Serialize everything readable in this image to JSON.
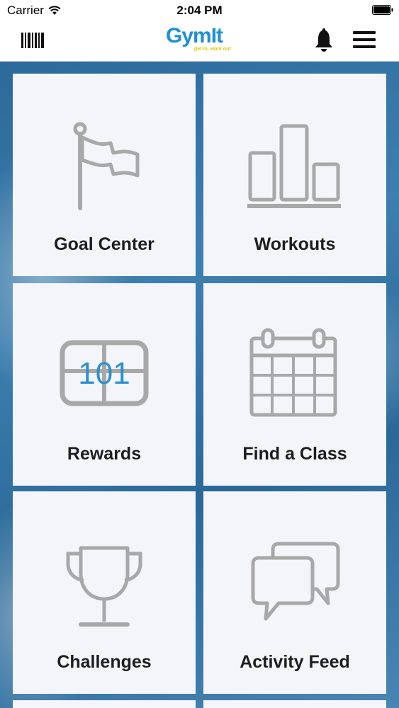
{
  "status_bar": {
    "carrier": "Carrier",
    "time": "2:04 PM"
  },
  "nav": {
    "logo_text": "GymIt",
    "logo_tagline": "get in, work out",
    "icons": [
      "barcode-icon",
      "bell-icon",
      "hamburger-menu-icon"
    ]
  },
  "tiles": [
    {
      "label": "Goal Center",
      "icon": "flag-icon"
    },
    {
      "label": "Workouts",
      "icon": "bar-chart-icon"
    },
    {
      "label": "Rewards",
      "icon": "scoreboard-icon",
      "icon_text": "101"
    },
    {
      "label": "Find a Class",
      "icon": "calendar-icon"
    },
    {
      "label": "Challenges",
      "icon": "trophy-icon"
    },
    {
      "label": "Activity Feed",
      "icon": "chat-bubbles-icon"
    }
  ],
  "colors": {
    "brand_blue": "#1c8fd6",
    "brand_yellow": "#e6c400",
    "tile_bg": "#f3f5f8",
    "icon_gray": "#a8a8a8",
    "background_blue": "#3d7fb0"
  }
}
